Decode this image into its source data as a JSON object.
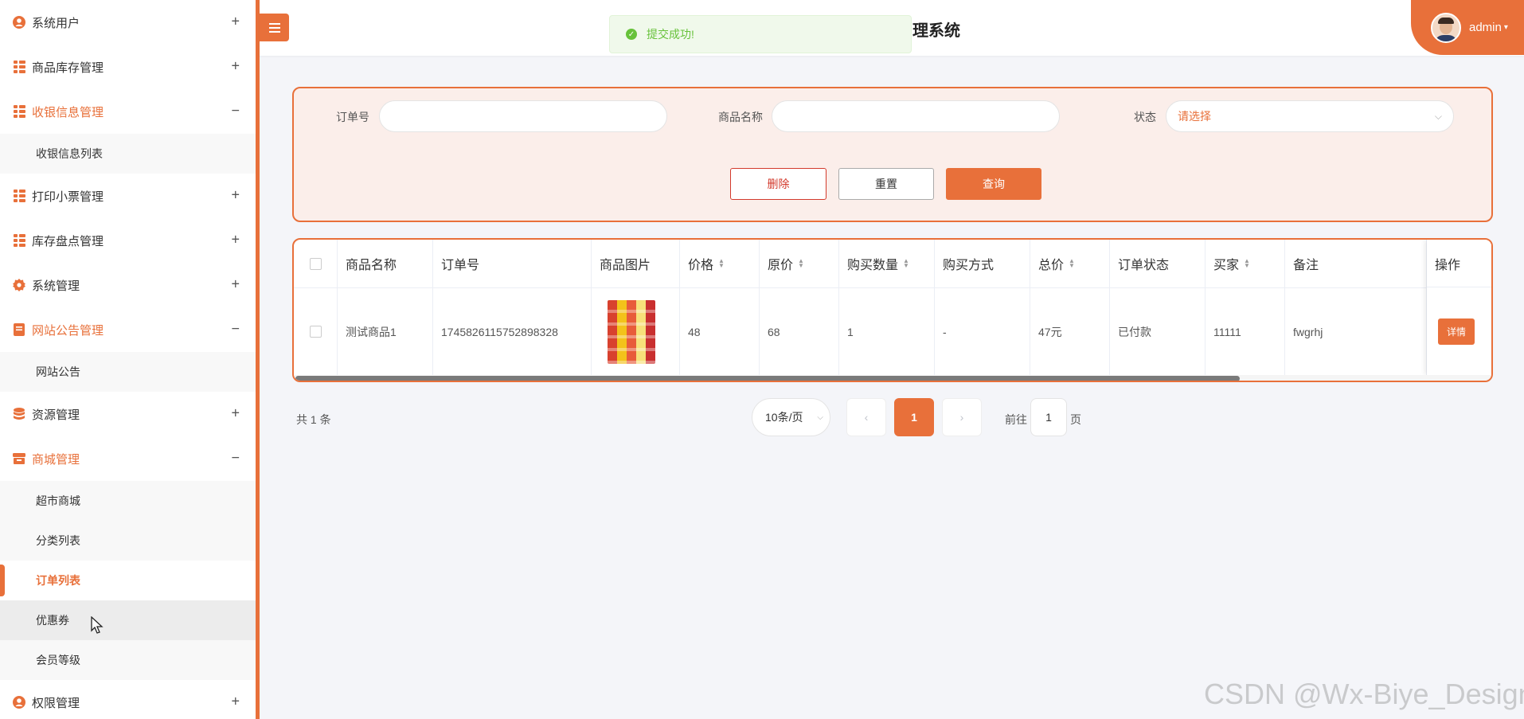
{
  "sidebar": {
    "items": [
      {
        "label": "系统用户",
        "toggle": "+",
        "icon": "user-circle-icon"
      },
      {
        "label": "商品库存管理",
        "toggle": "+",
        "icon": "grid-icon"
      },
      {
        "label": "收银信息管理",
        "toggle": "−",
        "icon": "grid-icon",
        "children": [
          "收银信息列表"
        ]
      },
      {
        "label": "打印小票管理",
        "toggle": "+",
        "icon": "grid-icon"
      },
      {
        "label": "库存盘点管理",
        "toggle": "+",
        "icon": "grid-icon"
      },
      {
        "label": "系统管理",
        "toggle": "+",
        "icon": "gear-icon"
      },
      {
        "label": "网站公告管理",
        "toggle": "−",
        "icon": "document-icon",
        "children": [
          "网站公告"
        ]
      },
      {
        "label": "资源管理",
        "toggle": "+",
        "icon": "database-icon"
      },
      {
        "label": "商城管理",
        "toggle": "−",
        "icon": "shop-icon",
        "children": [
          "超市商城",
          "分类列表",
          "订单列表",
          "优惠券",
          "会员等级"
        ]
      },
      {
        "label": "权限管理",
        "toggle": "+",
        "icon": "user-circle-icon"
      }
    ],
    "active_child": "订单列表",
    "hovered_child": "优惠券"
  },
  "header": {
    "title_partial": "理系统",
    "menu_icon": "hamburger-icon",
    "user": {
      "name": "admin",
      "caret": "▾"
    }
  },
  "toast": {
    "text": "提交成功!",
    "icon": "check-circle-icon",
    "color": "#67c23a"
  },
  "search": {
    "order_no_label": "订单号",
    "order_no_value": "",
    "product_name_label": "商品名称",
    "product_name_value": "",
    "status_label": "状态",
    "status_placeholder": "请选择",
    "buttons": {
      "delete": "删除",
      "reset": "重置",
      "query": "查询"
    }
  },
  "table": {
    "columns": [
      "商品名称",
      "订单号",
      "商品图片",
      "价格",
      "原价",
      "购买数量",
      "购买方式",
      "总价",
      "订单状态",
      "买家",
      "备注",
      "操作"
    ],
    "rows": [
      {
        "product_name": "测试商品1",
        "order_no": "1745826115752898328",
        "price": "48",
        "original_price": "68",
        "quantity": "1",
        "purchase_method": "-",
        "total": "47元",
        "status": "已付款",
        "buyer": "11111",
        "remark": "fwgrhj",
        "action": "详情"
      }
    ]
  },
  "pagination": {
    "total_text": "共 1 条",
    "page_size": "10条/页",
    "prev": "‹",
    "current_page": "1",
    "next": "›",
    "goto_prefix": "前往",
    "goto_value": "1",
    "goto_suffix": "页"
  },
  "watermark": "CSDN @Wx-Biye_Design",
  "colors": {
    "accent": "#e8703a",
    "danger": "#d33a2c",
    "success": "#67c23a",
    "panel_bg": "#fbeeea"
  }
}
